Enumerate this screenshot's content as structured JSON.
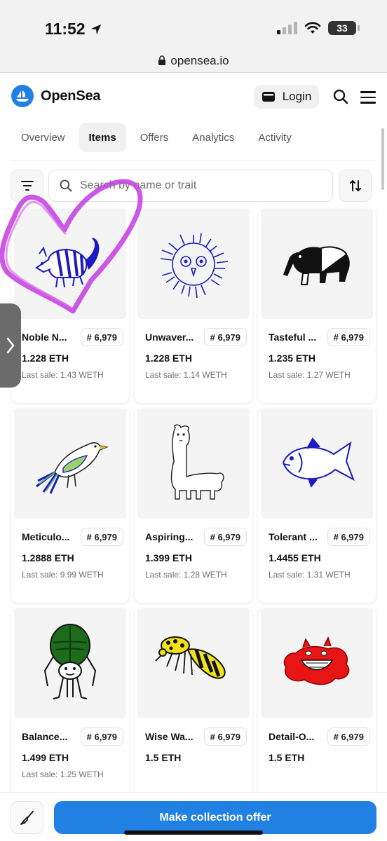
{
  "status_bar": {
    "time": "11:52",
    "battery": "33"
  },
  "browser": {
    "url": "opensea.io"
  },
  "header": {
    "brand": "OpenSea",
    "login_label": "Login"
  },
  "tabs": [
    {
      "label": "Overview",
      "active": false
    },
    {
      "label": "Items",
      "active": true
    },
    {
      "label": "Offers",
      "active": false
    },
    {
      "label": "Analytics",
      "active": false
    },
    {
      "label": "Activity",
      "active": false
    }
  ],
  "search": {
    "placeholder": "Search by name or trait"
  },
  "items": [
    {
      "name": "Noble N...",
      "rank": "# 6,979",
      "price": "1.228 ETH",
      "last_sale": "Last sale: 1.43 WETH",
      "art": "armadillo"
    },
    {
      "name": "Unwaver...",
      "rank": "# 6,979",
      "price": "1.228 ETH",
      "last_sale": "Last sale: 1.14 WETH",
      "art": "owl"
    },
    {
      "name": "Tasteful ...",
      "rank": "# 6,979",
      "price": "1.235 ETH",
      "last_sale": "Last sale: 1.27 WETH",
      "art": "tapir"
    },
    {
      "name": "Meticulo...",
      "rank": "# 6,979",
      "price": "1.2888 ETH",
      "last_sale": "Last sale: 9.99 WETH",
      "art": "bird"
    },
    {
      "name": "Aspiring...",
      "rank": "# 6,979",
      "price": "1.399 ETH",
      "last_sale": "Last sale: 1.28 WETH",
      "art": "llama"
    },
    {
      "name": "Tolerant ...",
      "rank": "# 6,979",
      "price": "1.4455 ETH",
      "last_sale": "Last sale: 1.31 WETH",
      "art": "fish"
    },
    {
      "name": "Balance...",
      "rank": "# 6,979",
      "price": "1.499 ETH",
      "last_sale": "Last sale: 1.25 WETH",
      "art": "beetle"
    },
    {
      "name": "Wise Wa...",
      "rank": "# 6,979",
      "price": "1.5 ETH",
      "last_sale": "",
      "art": "wasp"
    },
    {
      "name": "Detail-O...",
      "rank": "# 6,979",
      "price": "1.5 ETH",
      "last_sale": "",
      "art": "blob"
    }
  ],
  "bottom_bar": {
    "offer_label": "Make collection offer"
  },
  "colors": {
    "accent": "#2081e2",
    "heart_doodle": "#c43be0"
  }
}
